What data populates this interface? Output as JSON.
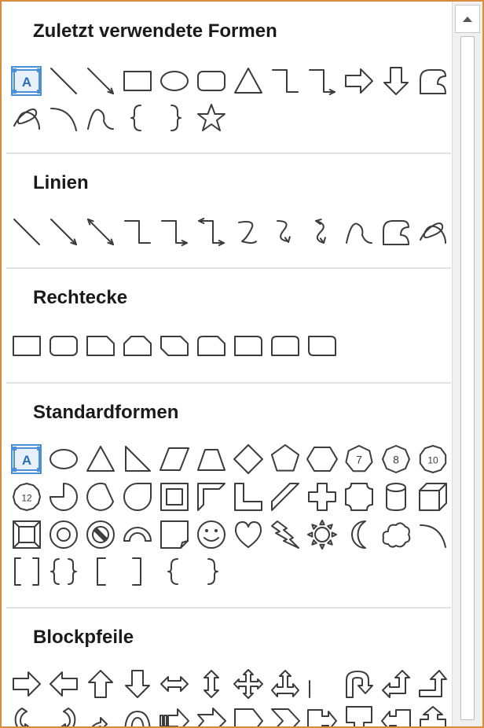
{
  "sections": [
    {
      "key": "recent",
      "title": "Zuletzt verwendete Formen",
      "shapes": [
        "text-box-icon",
        "line-icon",
        "arrow-line-icon",
        "rectangle-icon",
        "oval-icon",
        "rounded-rectangle-icon",
        "triangle-icon",
        "elbow-connector-icon",
        "elbow-arrow-connector-icon",
        "right-arrow-icon",
        "down-arrow-icon",
        "freeform-icon",
        "scribble-icon",
        "arc-icon",
        "curve-icon",
        "left-brace-icon",
        "right-brace-icon",
        "star-icon"
      ]
    },
    {
      "key": "lines",
      "title": "Linien",
      "shapes": [
        "line-icon",
        "arrow-line-icon",
        "double-arrow-line-icon",
        "elbow-connector-icon",
        "elbow-arrow-connector-icon",
        "elbow-double-arrow-connector-icon",
        "curved-connector-icon",
        "curved-arrow-connector-icon",
        "curved-double-arrow-connector-icon",
        "curve-icon",
        "freeform-icon",
        "scribble-icon"
      ]
    },
    {
      "key": "rects",
      "title": "Rechtecke",
      "shapes": [
        "rectangle-icon",
        "rounded-rectangle-icon",
        "snip-single-corner-rectangle-icon",
        "snip-same-side-rectangle-icon",
        "snip-diagonal-rectangle-icon",
        "snip-round-rectangle-icon",
        "round-single-corner-rectangle-icon",
        "round-same-side-rectangle-icon",
        "round-diagonal-rectangle-icon"
      ]
    },
    {
      "key": "basic",
      "title": "Standardformen",
      "shapes": [
        "text-box-icon",
        "oval-icon",
        "triangle-icon",
        "right-triangle-icon",
        "parallelogram-icon",
        "trapezoid-icon",
        "diamond-icon",
        "pentagon-icon",
        "hexagon-icon",
        "heptagon-icon",
        "octagon-icon",
        "decagon-icon",
        "dodecagon-icon",
        "pie-icon",
        "chord-icon",
        "teardrop-icon",
        "frame-icon",
        "half-frame-icon",
        "l-shape-icon",
        "diagonal-stripe-icon",
        "cross-icon",
        "plaque-icon",
        "can-icon",
        "cube-icon",
        "bevel-icon",
        "donut-icon",
        "no-symbol-icon",
        "block-arc-icon",
        "folded-corner-icon",
        "smiley-face-icon",
        "heart-icon",
        "lightning-bolt-icon",
        "sun-icon",
        "moon-icon",
        "cloud-icon",
        "arc-icon",
        "double-bracket-icon",
        "double-brace-icon",
        "left-bracket-icon",
        "right-bracket-icon",
        "left-brace-icon",
        "right-brace-icon"
      ],
      "badges": {
        "heptagon-icon": "7",
        "octagon-icon": "8",
        "decagon-icon": "10",
        "dodecagon-icon": "12"
      }
    },
    {
      "key": "arrows",
      "title": "Blockpfeile",
      "shapes": [
        "right-arrow-icon",
        "left-arrow-icon",
        "up-arrow-icon",
        "down-arrow-icon",
        "left-right-arrow-icon",
        "up-down-arrow-icon",
        "quad-arrow-icon",
        "left-right-up-arrow-icon",
        "bent-arrow-icon",
        "u-turn-arrow-icon",
        "left-up-arrow-icon",
        "bent-up-arrow-icon",
        "curved-right-arrow-icon",
        "curved-left-arrow-icon",
        "curved-up-arrow-icon",
        "curved-down-arrow-icon",
        "striped-right-arrow-icon",
        "notched-right-arrow-icon",
        "pentagon-arrow-icon",
        "chevron-icon",
        "right-arrow-callout-icon",
        "down-arrow-callout-icon",
        "left-arrow-callout-icon",
        "up-arrow-callout-icon"
      ]
    }
  ],
  "colors": {
    "panel_border": "#d98c3a",
    "shape_stroke": "#3c3c3c",
    "selection": "#4a90d9",
    "separator": "#e2e2e2"
  }
}
